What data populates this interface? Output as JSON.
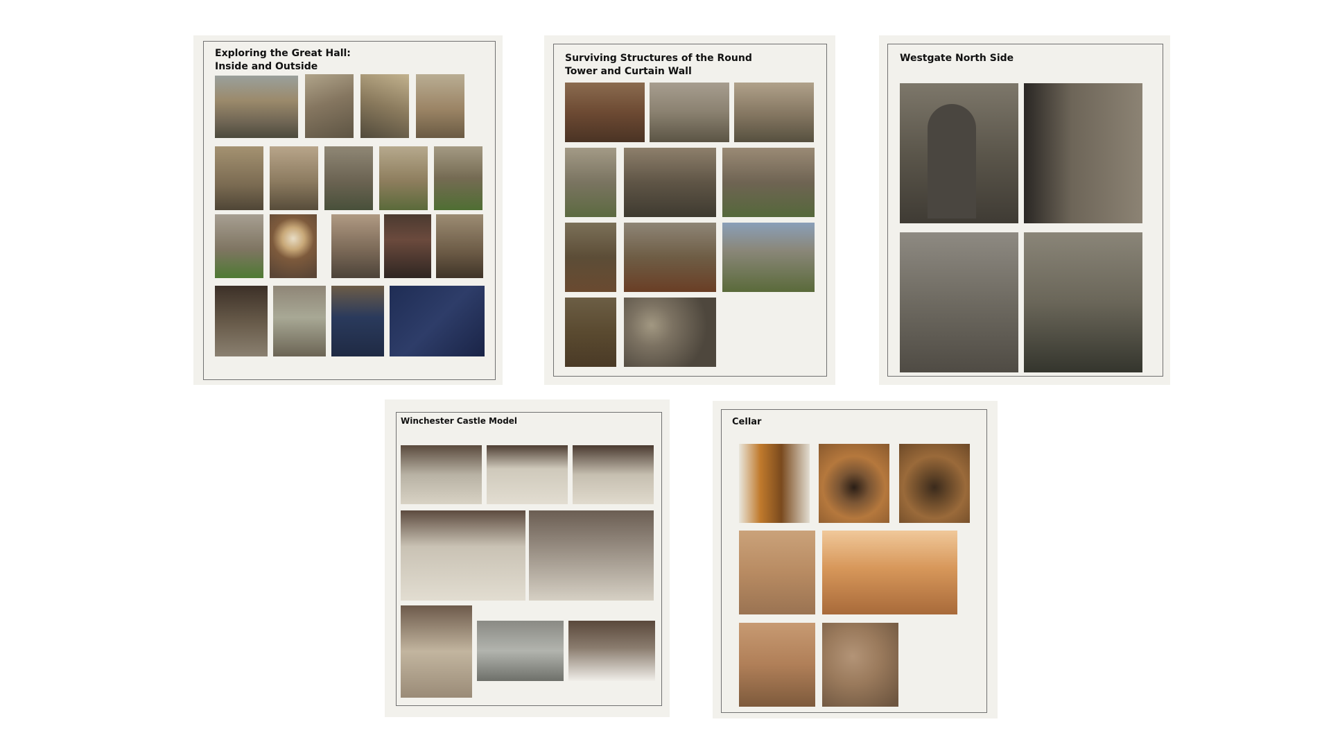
{
  "panels": [
    {
      "title": "Exploring the Great Hall: Inside and Outside"
    },
    {
      "title": "Surviving Structures of the Round Tower and Curtain Wall"
    },
    {
      "title": "Westgate North Side"
    },
    {
      "title": "Winchester Castle Model"
    },
    {
      "title": "Cellar"
    }
  ],
  "colors": {
    "background": "#ffffff",
    "panel": "#f2f1ec",
    "frame_border": "#6f6f6f",
    "title_text": "#111111"
  }
}
